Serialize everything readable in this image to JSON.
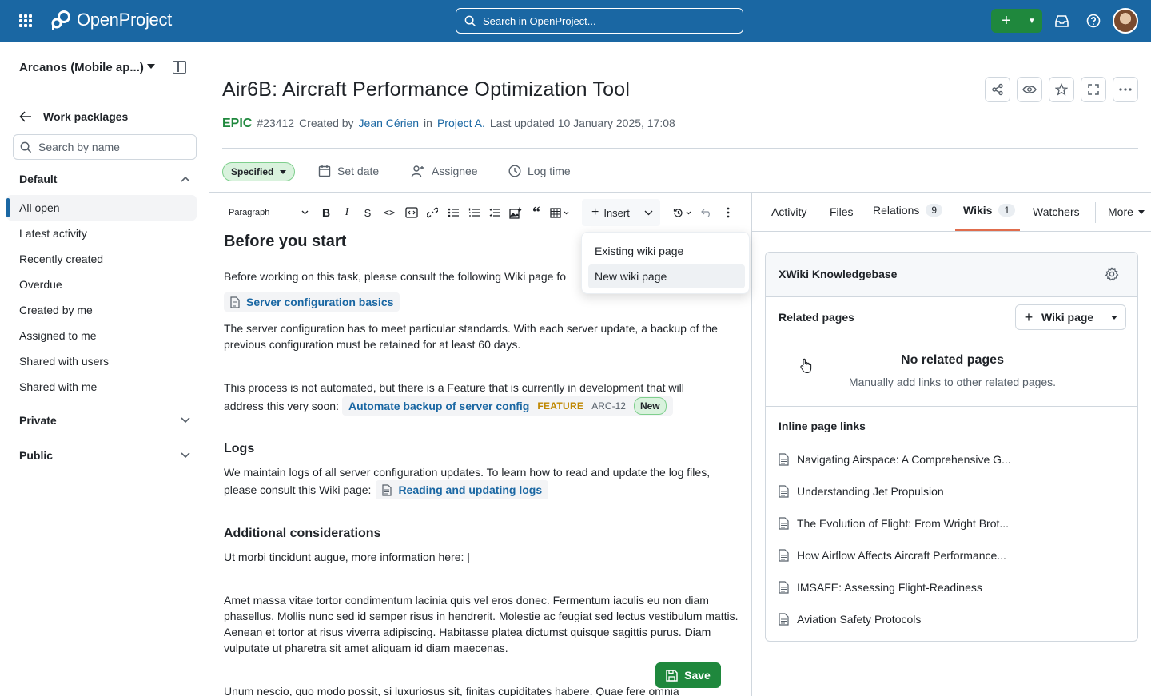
{
  "header": {
    "brand": "OpenProject",
    "search_placeholder": "Search in OpenProject...",
    "add_button_label": "+"
  },
  "sidebar": {
    "project_name": "Arcanos (Mobile ap...)",
    "back_label": "Work packlages",
    "search_placeholder": "Search by name",
    "groups": {
      "default": "Default",
      "private": "Private",
      "public": "Public"
    },
    "items": [
      {
        "label": "All open",
        "active": true
      },
      {
        "label": "Latest activity"
      },
      {
        "label": "Recently created"
      },
      {
        "label": "Overdue"
      },
      {
        "label": "Created by me"
      },
      {
        "label": "Assigned to me"
      },
      {
        "label": "Shared with users"
      },
      {
        "label": "Shared with me"
      }
    ]
  },
  "work_package": {
    "title": "Air6B: Aircraft Performance Optimization Tool",
    "type": "EPIC",
    "id": "#23412",
    "created_by_prefix": "Created by",
    "author": "Jean Cérien",
    "in_label": "in",
    "project": "Project A.",
    "updated": "Last updated 10 January 2025, 17:08",
    "status": "Specified",
    "actions": {
      "set_date": "Set date",
      "assignee": "Assignee",
      "log_time": "Log time"
    }
  },
  "toolbar": {
    "paragraph": "Paragraph",
    "insert": "Insert"
  },
  "insert_menu": {
    "items": [
      "Existing wiki page",
      "New wiki page"
    ],
    "selected": "New wiki page"
  },
  "editor": {
    "h_before": "Before you start",
    "p1": "Before working on this task, please consult the following Wiki page fo",
    "chip_server_config": "Server configuration basics",
    "p2": "The server configuration has to meet particular standards. With each server update, a backup of the previous configuration must be retained for at least 60 days.",
    "p3a": "This process is not automated, but there is a Feature that is currently in development that will",
    "p3b": "address this very soon:",
    "feature_title": "Automate backup of server config",
    "feature_type": "FEATURE",
    "feature_id": "ARC-12",
    "feature_status": "New",
    "h_logs": "Logs",
    "p4a": "We maintain logs of all server configuration updates. To learn how to read and update the log files,",
    "p4b": "please consult this Wiki page:",
    "chip_logs": "Reading and updating logs",
    "h_additional": "Additional considerations",
    "p5": "Ut morbi tincidunt augue, more information here: |",
    "p6": "Amet massa vitae tortor condimentum lacinia quis vel eros donec. Fermentum iaculis eu non diam phasellus. Mollis nunc sed id semper risus in hendrerit. Molestie ac feugiat sed lectus vestibulum mattis. Aenean et tortor at risus viverra adipiscing. Habitasse platea dictumst quisque sagittis purus. Diam vulputate ut pharetra sit amet aliquam id diam maecenas.",
    "p7": "Unum nescio, quo modo possit, si luxuriosus sit, finitas cupiditates  habere. Quae fere omnia",
    "save_label": "Save"
  },
  "tabs": {
    "activity": "Activity",
    "files": "Files",
    "relations": "Relations",
    "relations_count": "9",
    "wikis": "Wikis",
    "wikis_count": "1",
    "watchers": "Watchers",
    "more": "More"
  },
  "wiki_panel": {
    "title": "XWiki Knowledgebase",
    "related_label": "Related pages",
    "add_button": "Wiki page",
    "empty_title": "No related pages",
    "empty_sub": "Manually add links to other related pages.",
    "inline_label": "Inline page links",
    "links": [
      "Navigating Airspace: A Comprehensive G...",
      "Understanding Jet Propulsion",
      "The Evolution of Flight: From Wright Brot...",
      "How Airflow Affects Aircraft Performance...",
      "IMSAFE: Assessing Flight-Readiness",
      "Aviation Safety Protocols"
    ]
  },
  "colors": {
    "brand_blue": "#1a67a3",
    "success_green": "#1f883d",
    "tab_accent": "#e06c4c"
  }
}
